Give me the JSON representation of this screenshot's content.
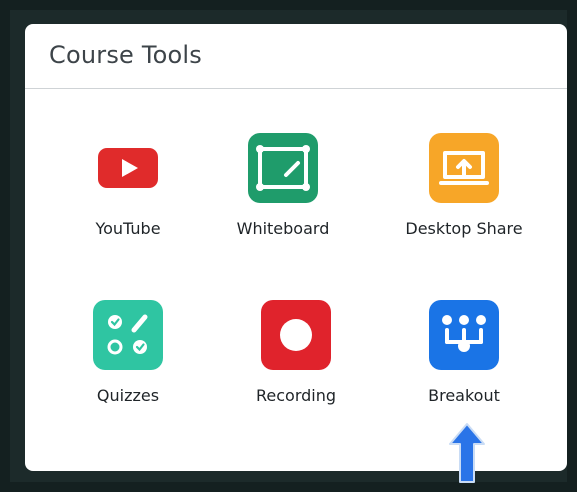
{
  "panel": {
    "title": "Course Tools"
  },
  "tools": [
    {
      "label": "YouTube",
      "icon": "youtube-icon",
      "color": "#e02b2b"
    },
    {
      "label": "Whiteboard",
      "icon": "whiteboard-icon",
      "color": "#1f9c6b"
    },
    {
      "label": "Desktop Share",
      "icon": "desktop-share-icon",
      "color": "#f7a628"
    },
    {
      "label": "Quizzes",
      "icon": "quizzes-icon",
      "color": "#2fc5a2"
    },
    {
      "label": "Recording",
      "icon": "recording-icon",
      "color": "#e0232c"
    },
    {
      "label": "Breakout",
      "icon": "breakout-icon",
      "color": "#1a74e6"
    }
  ],
  "annotation": {
    "icon": "up-arrow-icon",
    "color": "#2a74e8"
  }
}
